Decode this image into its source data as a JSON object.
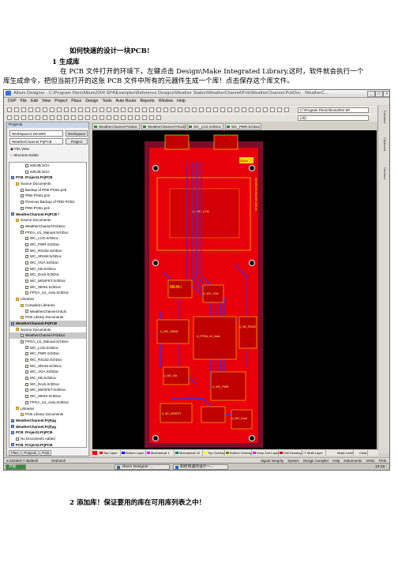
{
  "doc": {
    "title": "如何快速的设计一块PCB!",
    "step1": "1 生成库",
    "para1": "在 PCB 文件打开的环境下，左键点击 Design\\Make Integrated Library,这时，软件就会执行一个",
    "para2": "库生成命令，把但当前打开的这张 PCB 文件中所有的元器件生成一个库！点击保存这个库文件。",
    "step2": "2 添加库！保证要用的库在可用库列表之中！"
  },
  "window": {
    "title": "Altium Designer - C:\\Program Files\\Altium2004 SP4\\Examples\\Reference Designs\\Weather Station\\WeatherChannel\\Pcb\\WeatherChannel.PcbDoc - WeatherC...",
    "menus": [
      "DXP",
      "File",
      "Edit",
      "View",
      "Project",
      "Place",
      "Design",
      "Tools",
      "Auto Route",
      "Reports",
      "Window",
      "Help"
    ],
    "path_value": "C:\\Program Files\\Altium2004 SP",
    "filter_value": "(All)"
  },
  "panel": {
    "header": "Projects",
    "workspace_value": "Workspace1.DsnWrk",
    "workspace_button": "Workspace",
    "project_value": "WeatherChannel.PrjPCB",
    "project_button": "Project",
    "mode_file": "File View",
    "mode_structure": "Structure Editor",
    "tabs": [
      "Files",
      "Projects",
      "PCB"
    ]
  },
  "tree": [
    {
      "label": "53lc2B.SCH",
      "kind": "file",
      "indent": 3
    },
    {
      "label": "53lc2B.SCH",
      "kind": "file",
      "indent": 3
    },
    {
      "label": "PCB_Project1.PrjPCB",
      "kind": "proj",
      "indent": 0
    },
    {
      "label": "Source Documents",
      "kind": "fold",
      "indent": 1
    },
    {
      "label": "Backup of PDE-PCB1.pcb",
      "kind": "file",
      "indent": 2
    },
    {
      "label": "PDE-PCB1.pcb",
      "kind": "file",
      "indent": 2
    },
    {
      "label": "Previous Backup of PDE-PCB1",
      "kind": "file",
      "indent": 2
    },
    {
      "label": "PDE-PCB1.pcb",
      "kind": "file",
      "indent": 2
    },
    {
      "label": "WeatherChannel.PrjPCB *",
      "kind": "proj",
      "indent": 0
    },
    {
      "label": "Source Documents",
      "kind": "fold",
      "indent": 1
    },
    {
      "label": "WeatherChannel.PcbDoc",
      "kind": "file",
      "indent": 2
    },
    {
      "label": "FPGA_U1_Manual.SchDoc",
      "kind": "file",
      "indent": 2
    },
    {
      "label": "WC_LCD.SchDoc",
      "kind": "file",
      "indent": 3
    },
    {
      "label": "WC_PWR.SchDoc",
      "kind": "file",
      "indent": 3
    },
    {
      "label": "WC_RS232.SchDoc",
      "kind": "file",
      "indent": 3
    },
    {
      "label": "WC_SRAM.SchDoc",
      "kind": "file",
      "indent": 3
    },
    {
      "label": "WC_VGA.SchDoc",
      "kind": "file",
      "indent": 3
    },
    {
      "label": "WC_KB.SchDoc",
      "kind": "file",
      "indent": 3
    },
    {
      "label": "WC_Dock.SchDoc",
      "kind": "file",
      "indent": 3
    },
    {
      "label": "WC_MOSFET.SchDoc",
      "kind": "file",
      "indent": 3
    },
    {
      "label": "WC_SENS.SchDoc",
      "kind": "file",
      "indent": 3
    },
    {
      "label": "FPGA_U1_Auto.SchDoc",
      "kind": "file",
      "indent": 3
    },
    {
      "label": "Libraries",
      "kind": "fold",
      "indent": 1
    },
    {
      "label": "Compiled Libraries",
      "kind": "fold",
      "indent": 2
    },
    {
      "label": "WeatherChannel.IntLib",
      "kind": "file",
      "indent": 3
    },
    {
      "label": "PCB Library Documents",
      "kind": "fold",
      "indent": 2
    },
    {
      "label": "WeatherChannel.PrjPCB",
      "kind": "proj",
      "indent": 0,
      "sel": true
    },
    {
      "label": "Source Documents",
      "kind": "fold",
      "indent": 1
    },
    {
      "label": "WeatherChannel.PcbDoc",
      "kind": "file",
      "indent": 2,
      "sel": true
    },
    {
      "label": "FPGA_U1_Manual.SchDoc",
      "kind": "file",
      "indent": 2
    },
    {
      "label": "WC_LCD.SchDoc",
      "kind": "file",
      "indent": 3
    },
    {
      "label": "WC_PWR.SchDoc",
      "kind": "file",
      "indent": 3
    },
    {
      "label": "WC_RS232.SchDoc",
      "kind": "file",
      "indent": 3
    },
    {
      "label": "WC_SRAM.SchDoc",
      "kind": "file",
      "indent": 3
    },
    {
      "label": "WC_VGA.SchDoc",
      "kind": "file",
      "indent": 3
    },
    {
      "label": "WC_KB.SchDoc",
      "kind": "file",
      "indent": 3
    },
    {
      "label": "WC_Dock.SchDoc",
      "kind": "file",
      "indent": 3
    },
    {
      "label": "WC_MOSFET.SchDoc",
      "kind": "file",
      "indent": 3
    },
    {
      "label": "WC_SENS.SchDoc",
      "kind": "file",
      "indent": 3
    },
    {
      "label": "FPGA_U1_Auto.SchDoc",
      "kind": "file",
      "indent": 3
    },
    {
      "label": "Libraries",
      "kind": "fold",
      "indent": 1
    },
    {
      "label": "PCB Library Documents",
      "kind": "fold",
      "indent": 2
    },
    {
      "label": "WeatherChannel.PrjFpg",
      "kind": "proj",
      "indent": 0
    },
    {
      "label": "WeatherChannel.PrjFpg",
      "kind": "proj",
      "indent": 0
    },
    {
      "label": "PCB_Project2.PrjPCB",
      "kind": "proj",
      "indent": 0
    },
    {
      "label": "No Documents Added",
      "kind": "file",
      "indent": 1
    },
    {
      "label": "PCB_Project2.PrjPCB",
      "kind": "proj",
      "indent": 0
    }
  ],
  "doc_tabs": [
    "WeatherChannel.PcbDoc",
    "WeatherChannel.PcbLib",
    "WC_LCD.SchDoc",
    "WC_PWR.SchDoc"
  ],
  "pcb_labels": {
    "lcd": "U_WC_LCD",
    "menu": "MENU",
    "fpga": "U_FPGA_U1_Auto",
    "sram": "U_WC_SRAM",
    "pwr": "U_WC_PWR",
    "kb": "U_WC_KB",
    "dock": "U_WC_Dock",
    "vga": "U_WC_VGA",
    "rs232": "U_WC_RS232",
    "mosfet": "U_WC_MOSFET",
    "altium": "Altium",
    "side_text": "WeatherChannel Altium"
  },
  "layers": [
    {
      "label": "Top Layer",
      "color": "#ff0000"
    },
    {
      "label": "Bottom Layer",
      "color": "#0000ff"
    },
    {
      "label": "Mechanical 1",
      "color": "#ff00ff"
    },
    {
      "label": "Mechanical 15",
      "color": "#008080"
    },
    {
      "label": "Top Overlay",
      "color": "#ffff00"
    },
    {
      "label": "Bottom Overlay",
      "color": "#808000"
    },
    {
      "label": "Keep-Out Layer",
      "color": "#ff00ff"
    },
    {
      "label": "Drill Drawing",
      "color": "#c00000"
    },
    {
      "label": "Multi-Layer",
      "color": "#c0c0c0"
    }
  ],
  "layer_right": [
    "Mask Level",
    "Clear"
  ],
  "status": {
    "coords": "X:3315mil Y:4525mil",
    "grid": "Grid:5mil",
    "right_items": [
      "Signal Integrity",
      "System",
      "Design Compiler",
      "Help",
      "Instruments",
      "VHDL",
      "PCB"
    ]
  },
  "side_tabs": [
    "Favorites",
    "Clipboard",
    "Libraries"
  ],
  "taskbar": {
    "start": "开始",
    "tasks": [
      "Altium Designer ...",
      "如何快速的设计一..."
    ],
    "clock": "13:18"
  }
}
